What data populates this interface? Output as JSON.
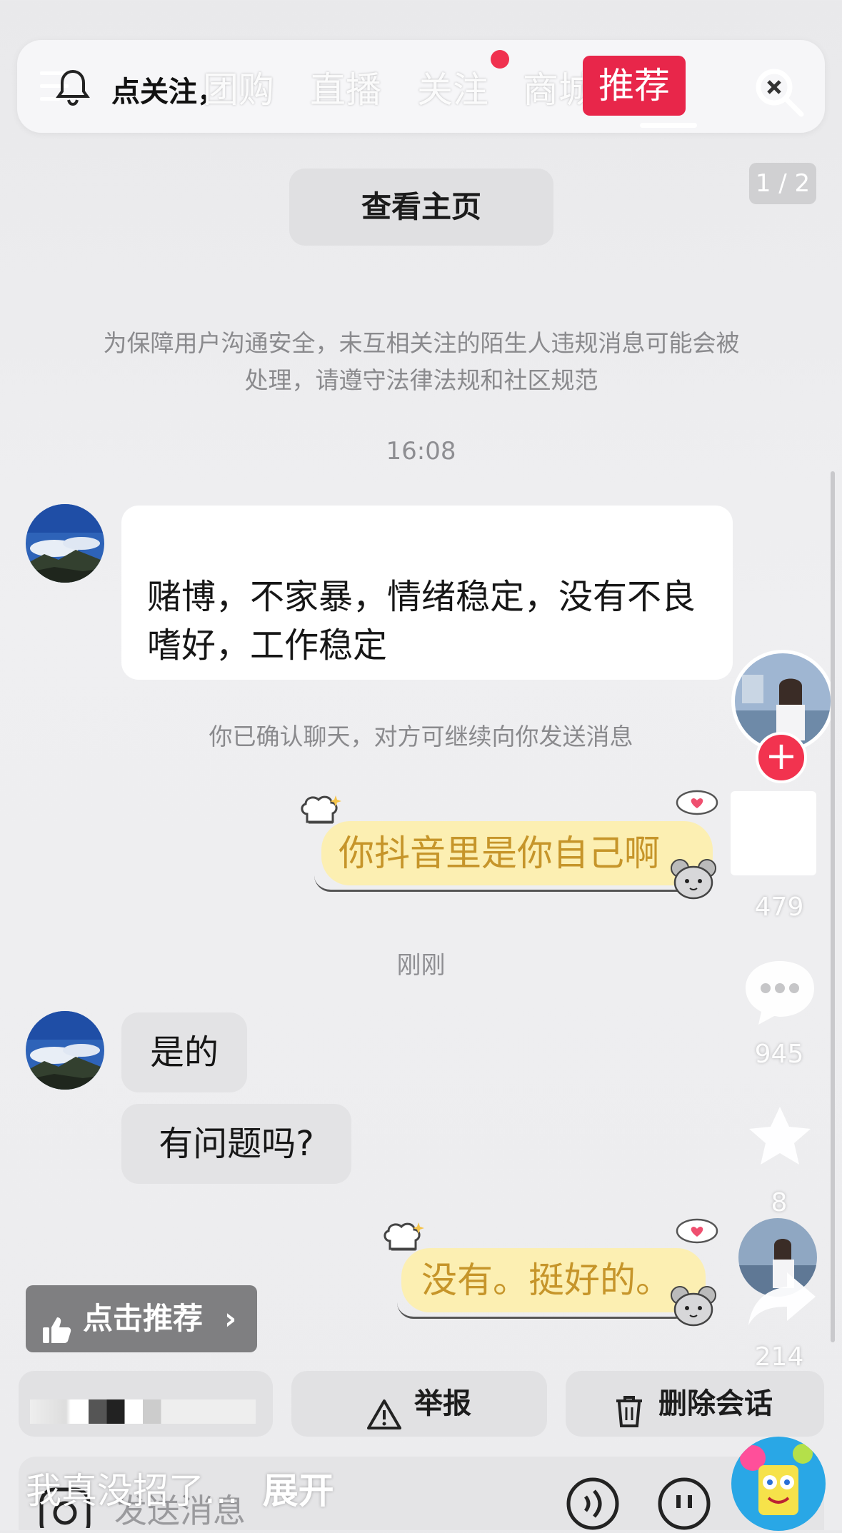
{
  "top_nav": {
    "follow_label": "点关注，",
    "tabs": [
      {
        "label": "团购"
      },
      {
        "label": "直播"
      },
      {
        "label": "关注"
      },
      {
        "label": "商城"
      },
      {
        "label": "推荐"
      }
    ],
    "active_tab": "推荐",
    "accent": "#e8264a"
  },
  "page_indicator": "1 / 2",
  "view_home_label": "查看主页",
  "safety_notice": "为保障用户沟通安全，未互相关注的陌生人违规消息可能会被处理，请遵守法律法规和社区规范",
  "chat": {
    "time1": "16:08",
    "msg1": "赌博，不家暴，情绪稳定，没有不良嗜好，工作稳定",
    "confirm_notice": "你已确认聊天，对方可继续向你发送消息",
    "sticker1": "你抖音里是你自己啊",
    "time2": "刚刚",
    "msg2": "是的",
    "msg3": "有问题吗?",
    "sticker2": "没有。挺好的。"
  },
  "right_rail": {
    "likes": "479",
    "comments": "945",
    "favorites": "8",
    "shares": "214"
  },
  "recommend_button": "点击推荐",
  "actions": {
    "report": "举报",
    "delete": "删除会话"
  },
  "caption": {
    "text": "我真没招了...",
    "expand": "展开"
  },
  "input_placeholder": "发送消息"
}
